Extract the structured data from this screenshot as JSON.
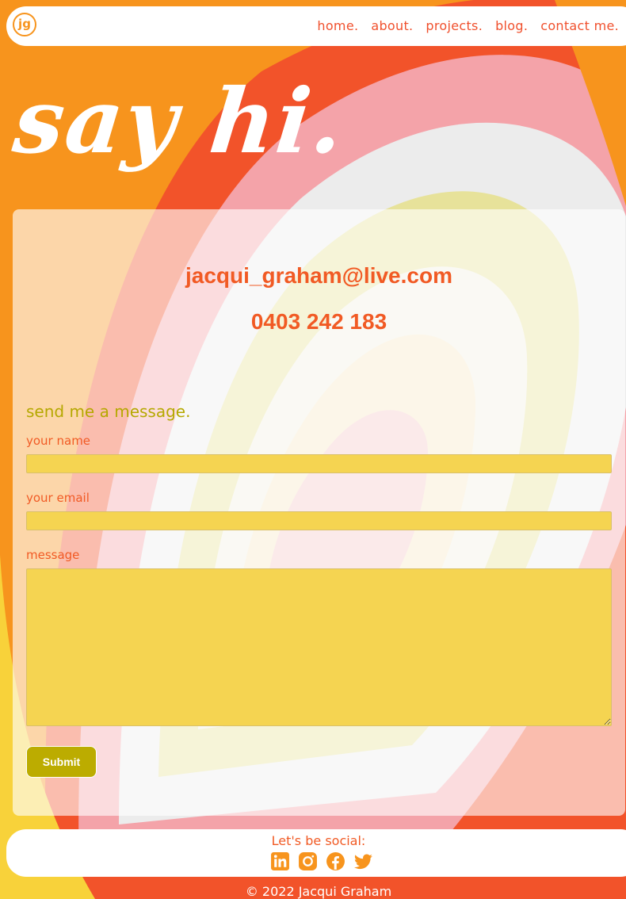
{
  "logo": {
    "text": "jg"
  },
  "nav": {
    "items": [
      "home.",
      "about.",
      "projects.",
      "blog.",
      "contact me."
    ]
  },
  "hero": {
    "title": "say hi."
  },
  "contact": {
    "email": "jacqui_graham@live.com",
    "phone": "0403 242 183"
  },
  "form": {
    "title": "send me a message.",
    "name_label": "your name",
    "email_label": "your email",
    "message_label": "message",
    "submit_label": "Submit"
  },
  "footer": {
    "social_title": "Let's be social:",
    "icons": [
      "linkedin-icon",
      "instagram-icon",
      "facebook-icon",
      "twitter-icon"
    ],
    "copyright": "© 2022 Jacqui Graham"
  },
  "colors": {
    "accent": "#f15a24",
    "brand_orange": "#f7941d",
    "olive": "#bcac00",
    "field_yellow": "#f5d451"
  }
}
